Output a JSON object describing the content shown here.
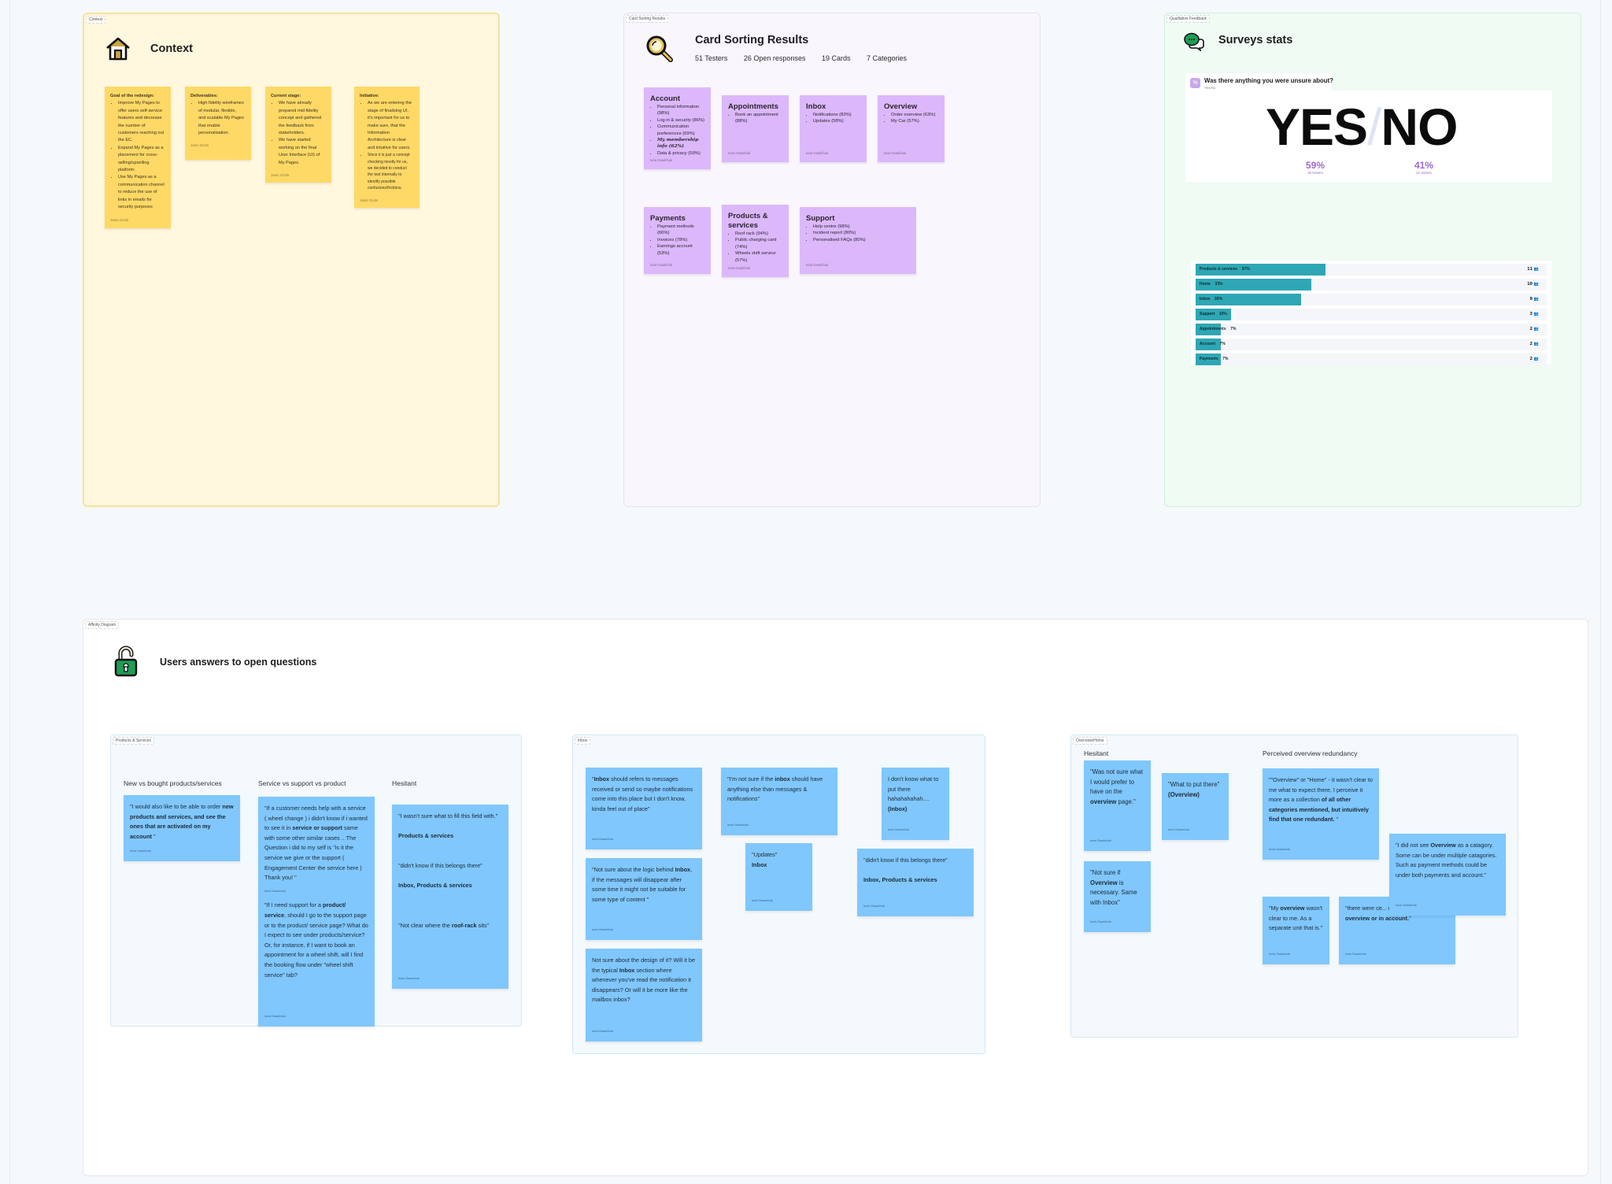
{
  "context": {
    "tag": "Context",
    "title": "Context",
    "icon": "house-icon",
    "notes": [
      {
        "heading": "Goal of the redesign:",
        "bullets": [
          "Improve My Pages to offer users self-service features and decrease the number of customers reaching out the EC.",
          "Expand My Pages as a placement for cross-selling/upselling platform.",
          "Use My Pages as a communication channel to reduce the use of links in emails for security purposes"
        ],
        "author": "Janis Ozols"
      },
      {
        "heading": "Deliverables:",
        "bullets": [
          "High fidelity wireframes of modular, flexible, and scalable My Pages that enable personalisation."
        ],
        "author": "Janis Ozols"
      },
      {
        "heading": "Current stage:",
        "bullets": [
          "We have already prepared mid fidelity concept and gathered the feedback from stakeholders.",
          "We have started working on the final User Interface (UI) of My Pages."
        ],
        "author": "Janis Ozols"
      },
      {
        "heading": "Initiative:",
        "bullets": [
          "As we are entering the stage of finalising UI, it's important for us to make sure, that the Information Architecture is clear and intuitive for users.",
          "Since it is just a concept checking mostly for us, we decided to conduct the test internally to identify possible confusions/frictions."
        ],
        "author": "Janis Ozols"
      }
    ]
  },
  "card_sorting": {
    "tag": "Card Sorting Results",
    "title": "Card Sorting Results",
    "icon": "magnifier-icon",
    "stats": [
      "51 Testers",
      "26 Open responses",
      "19 Cards",
      "7 Categories"
    ],
    "categories": [
      {
        "name": "Account",
        "items": [
          "Personal information (98%)",
          "Log in & security (86%)",
          "Communication preferences (69%)",
          "My membership info (62%)",
          "Data & privacy (59%)"
        ],
        "author": "Iuria Osadchuk"
      },
      {
        "name": "Appointments",
        "items": [
          "Book an appointment (88%)"
        ],
        "author": "Iuria Osadchuk"
      },
      {
        "name": "Inbox",
        "items": [
          "Notifications (83%)",
          "Updates (58%)"
        ],
        "author": "Iuria Osadchuk"
      },
      {
        "name": "Overview",
        "items": [
          "Order overview (63%)",
          "My Car (57%)"
        ],
        "author": "Iuria Osadchuk"
      },
      {
        "name": "Payments",
        "items": [
          "Payment methods (66%)",
          "Invoices (78%)",
          "Earnings account (53%)"
        ],
        "author": "Iuria Osadchuk"
      },
      {
        "name": "Products & services",
        "items": [
          "Roof rack (94%)",
          "Public charging card (74%)",
          "Wheels shift service (57%)"
        ],
        "author": "Iuria Osadchuk"
      },
      {
        "name": "Support",
        "items": [
          "Help centre (98%)",
          "Incident report (80%)",
          "Personalised FAQs (80%)"
        ],
        "author": "Iuria Osadchuk"
      }
    ]
  },
  "surveys": {
    "tag": "Qualitative Feedback",
    "title": "Surveys stats",
    "icon": "chat-bubbles-icon",
    "question": {
      "badge": "%",
      "text": "Was there anything you were unsure about?",
      "type": "Yes/No",
      "yes_label": "YES",
      "slash": "/",
      "no_label": "NO",
      "yes_pct": "59%",
      "yes_count": "30 testers",
      "no_pct": "41%",
      "no_count": "21 testers"
    },
    "bars": [
      {
        "label": "Products & services",
        "pct": 37,
        "pct_label": "37%",
        "count": "11"
      },
      {
        "label": "Home",
        "pct": 33,
        "pct_label": "33%",
        "count": "10"
      },
      {
        "label": "Inbox",
        "pct": 30,
        "pct_label": "30%",
        "count": "9"
      },
      {
        "label": "Support",
        "pct": 10,
        "pct_label": "10%",
        "count": "3"
      },
      {
        "label": "Appointments",
        "pct": 7,
        "pct_label": "7%",
        "count": "2"
      },
      {
        "label": "Account",
        "pct": 7,
        "pct_label": "7%",
        "count": "2"
      },
      {
        "label": "Payments",
        "pct": 7,
        "pct_label": "7%",
        "count": "2"
      }
    ],
    "people_icon": "people-icon"
  },
  "affinity": {
    "tag": "Affinity Diagram",
    "title": "Users answers to open questions",
    "icon": "unlocked-padlock-icon",
    "groups": [
      {
        "tag": "Products & Services",
        "columns": [
          "New vs bought products/services",
          "Service vs support vs product",
          "Hesitant"
        ],
        "notes": [
          {
            "html": "\"I would also like to be able to order <b>new products and services, and see the ones that are activated on my account</b> \"",
            "author": "Iuria Osadchuk"
          },
          {
            "html": "\"If a customer needs help with a service ( wheel change ) i didn't know if i wanted to see it in <b>service or support</b> same with some other similar cases .. The Question i did to my self is \"is it the service we give or the support ( Engagement Center the service here ) Thank you! \"",
            "author": "Iuria Osadchuk"
          },
          {
            "html": "\"If I need support for a <b>product/ service</b>, should I go to the support page or to the product/ service page? What do I expect to see under products/service? Or, for instance, if I want to book an appointment for a wheel shift, will I find the booking flow under \"wheel shift service\" tab?",
            "author": "Iuria Osadchuk"
          },
          {
            "html": "\"I wasn't sure what to fill this field with.\"<br><br><b>Products &amp; services</b><br><br><br>\"didn't know if this belongs there\"<br><br><b>Inbox, Products &amp; services</b><br><br><br><br>\"Not clear where the <b>roof-rack</b> sits\"",
            "author": "Iuria Osadchuk"
          }
        ]
      },
      {
        "tag": "Inbox",
        "notes": [
          {
            "html": "\"<b>Inbox</b> should refers to messages received or send so maybe notifications come into this place but I don't know, kinda feel out of place\"",
            "author": "Iuria Osadchuk"
          },
          {
            "html": "\"I'm not sure if the <b>inbox</b> should have anything else than messages &amp; notifications\"",
            "author": "Iuria Osadchuk"
          },
          {
            "html": "I don't know what to put there hahahahahah.... <b>(Inbox)</b>",
            "author": "Iuria Osadchuk"
          },
          {
            "html": "\"Not sure about the logic behind <b>Inbox</b>, if the messages will disappear after some time it might not be suitable for some type of content \"",
            "author": "Iuria Osadchuk"
          },
          {
            "html": "\"Updates\"<br><b>Inbox</b>",
            "author": "Iuria Osadchuk"
          },
          {
            "html": "\"didn't know if this belongs there\"<br><br><b>Inbox, Products &amp; services</b>",
            "author": "Iuria Osadchuk"
          },
          {
            "html": "Not sure about the design of it? Will it be the typical <b>Inbox</b> section where whenever you've read the notification it disappears? Or will it be more like the mailbox inbox?",
            "author": "Iuria Osadchuk"
          }
        ]
      },
      {
        "tag": "Overview/Home",
        "columns": [
          "Hesitant",
          "Perceived overview redundancy"
        ],
        "notes": [
          {
            "html": "\"Was not sure what I would prefer to have on the <b>overview</b> page.\"",
            "author": "Iuria Osadchuk"
          },
          {
            "html": "\"What to put there\" <b>(Overview)</b>",
            "author": "Iuria Osadchuk"
          },
          {
            "html": "\"Not sure if <b>Overview</b> is necessary. Same with Inbox\"",
            "author": "Iuria Osadchuk"
          },
          {
            "html": "\"\"Overview\" or \"Home\" - it wasn't clear to me what to expect there, I perceive it more as a collection <b>of all other categories mentioned, but intuitively find that one redundant.</b> \"",
            "author": "Iuria Osadchuk"
          },
          {
            "html": "\"My <b>overview</b> wasn't clear to me. As a separate unit that is.\"",
            "author": "Iuria Osadchuk"
          },
          {
            "html": "\"there were ce... could have fit both in <b>overview or in account.</b>\"",
            "author": "Iuria Osadchuk"
          },
          {
            "html": "\"I did not see <b>Overview</b> as a catagory. Some can be under multiple catagories. Such as payment methods could be under both payments and account.\"",
            "author": "Iuria Osadchuk"
          }
        ]
      }
    ]
  }
}
